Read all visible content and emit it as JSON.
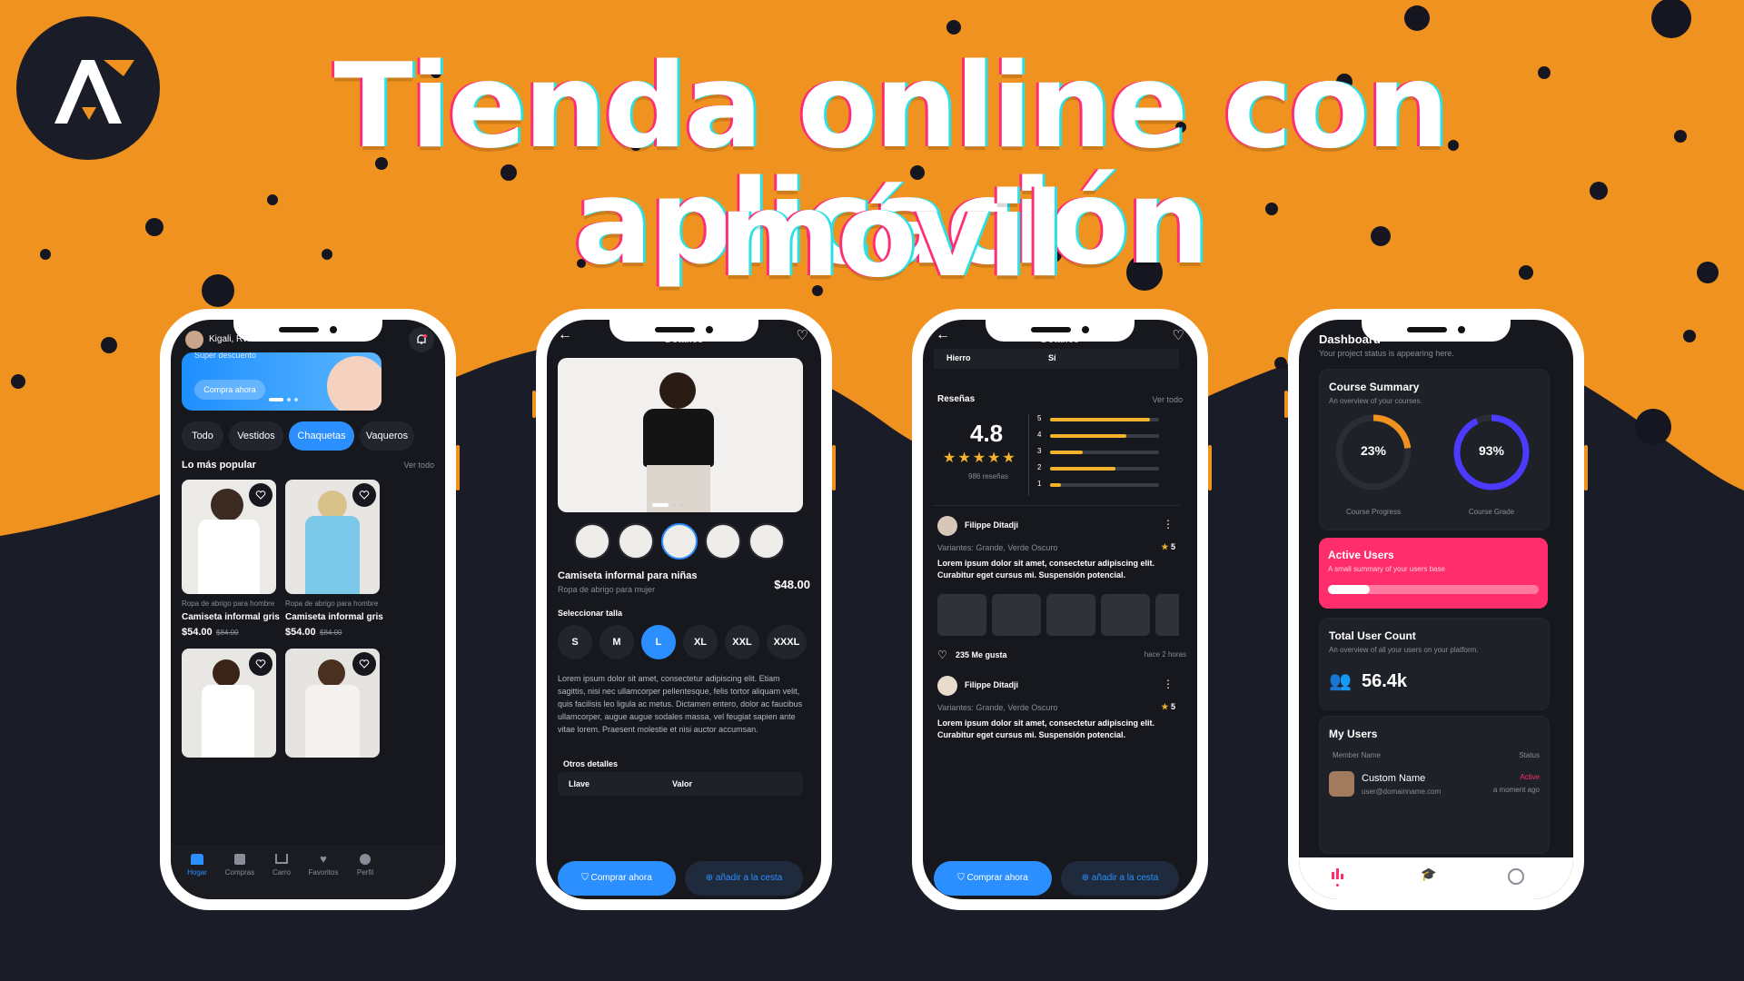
{
  "title_line1": "Tienda online con aplicación",
  "title_line2": "móvil",
  "colors": {
    "orange": "#f0921f",
    "dark": "#1a1c28",
    "accent_blue": "#2b8fff",
    "accent_pink": "#ff2d6b",
    "star": "#f2b22b"
  },
  "phone1": {
    "location": "Kigali, RW",
    "banner_text": "Súper descuento",
    "banner_button": "Compra ahora",
    "chips": [
      "Todo",
      "Vestidos",
      "Chaquetas",
      "Vaqueros"
    ],
    "section_title": "Lo más popular",
    "see_all": "Ver todo",
    "products": [
      {
        "category": "Ropa de abrigo para hombre",
        "name": "Camiseta informal gris",
        "price": "$54.00",
        "old_price": "$84.00"
      },
      {
        "category": "Ropa de abrigo para hombre",
        "name": "Camiseta informal gris",
        "price": "$54.00",
        "old_price": "$84.00"
      }
    ],
    "nav": [
      "Hogar",
      "Compras",
      "Carro",
      "Favoritos",
      "Perfil"
    ]
  },
  "phone2": {
    "header": "Detalles",
    "product_name": "Camiseta informal para niñas",
    "product_sub": "Ropa de abrigo para mujer",
    "price": "$48.00",
    "size_label": "Seleccionar talla",
    "sizes": [
      "S",
      "M",
      "L",
      "XL",
      "XXL",
      "XXXL"
    ],
    "selected_size": "L",
    "description": "Lorem ipsum dolor sit amet, consectetur adipiscing elit. Etiam sagittis, nisi nec ullamcorper pellentesque, felis tortor aliquam velit, quis facilisis leo ligula ac metus. Dictamen entero, dolor ac faucibus ullamcorper, augue augue sodales massa, vel feugiat sapien ante vitae lorem. Praesent molestie et nisi auctor accumsan.",
    "details_title": "Otros detalles",
    "col_key": "Llave",
    "col_value": "Valor",
    "buy_button": "Comprar ahora",
    "cart_button": "añadir a la cesta"
  },
  "phone3": {
    "header": "Detalles",
    "row_key": "Hierro",
    "row_value": "Sí",
    "reviews_title": "Reseñas",
    "see_all": "Ver todo",
    "rating": "4.8",
    "review_count": "986 reseñas",
    "rating_bars": [
      {
        "label": "5",
        "value": 0.92
      },
      {
        "label": "4",
        "value": 0.7
      },
      {
        "label": "3",
        "value": 0.3
      },
      {
        "label": "2",
        "value": 0.6
      },
      {
        "label": "1",
        "value": 0.1
      }
    ],
    "reviews": [
      {
        "name": "Filippe Ditadji",
        "variants": "Variantes: Grande, Verde Oscuro",
        "score": "5",
        "text": "Lorem ipsum dolor sit amet, consectetur adipiscing elit. Curabitur eget cursus mi. Suspensión potencial."
      },
      {
        "name": "Filippe Ditadji",
        "variants": "Variantes: Grande, Verde Oscuro",
        "score": "5",
        "text": "Lorem ipsum dolor sit amet, consectetur adipiscing elit. Curabitur eget cursus mi. Suspensión potencial."
      }
    ],
    "likes": "235 Me gusta",
    "time": "hace 2 horas",
    "buy_button": "Comprar ahora",
    "cart_button": "añadir a la cesta"
  },
  "phone4": {
    "title": "Dashboard",
    "subtitle": "Your project status is appearing here.",
    "course_title": "Course Summary",
    "course_sub": "An overview of your courses.",
    "progress_value": "23%",
    "progress_label": "Course Progress",
    "progress_fraction": 0.23,
    "grade_value": "93%",
    "grade_label": "Course Grade",
    "grade_fraction": 0.93,
    "active_title": "Active Users",
    "active_sub": "A small summary of your users base",
    "active_fraction": 0.2,
    "total_title": "Total User Count",
    "total_sub": "An overview of all your users on your platform.",
    "total_value": "56.4k",
    "users_title": "My Users",
    "col_member": "Member Name",
    "col_status": "Status",
    "user_name": "Custom Name",
    "user_email": "user@domainname.com",
    "user_status": "Active",
    "user_time": "a moment ago"
  }
}
